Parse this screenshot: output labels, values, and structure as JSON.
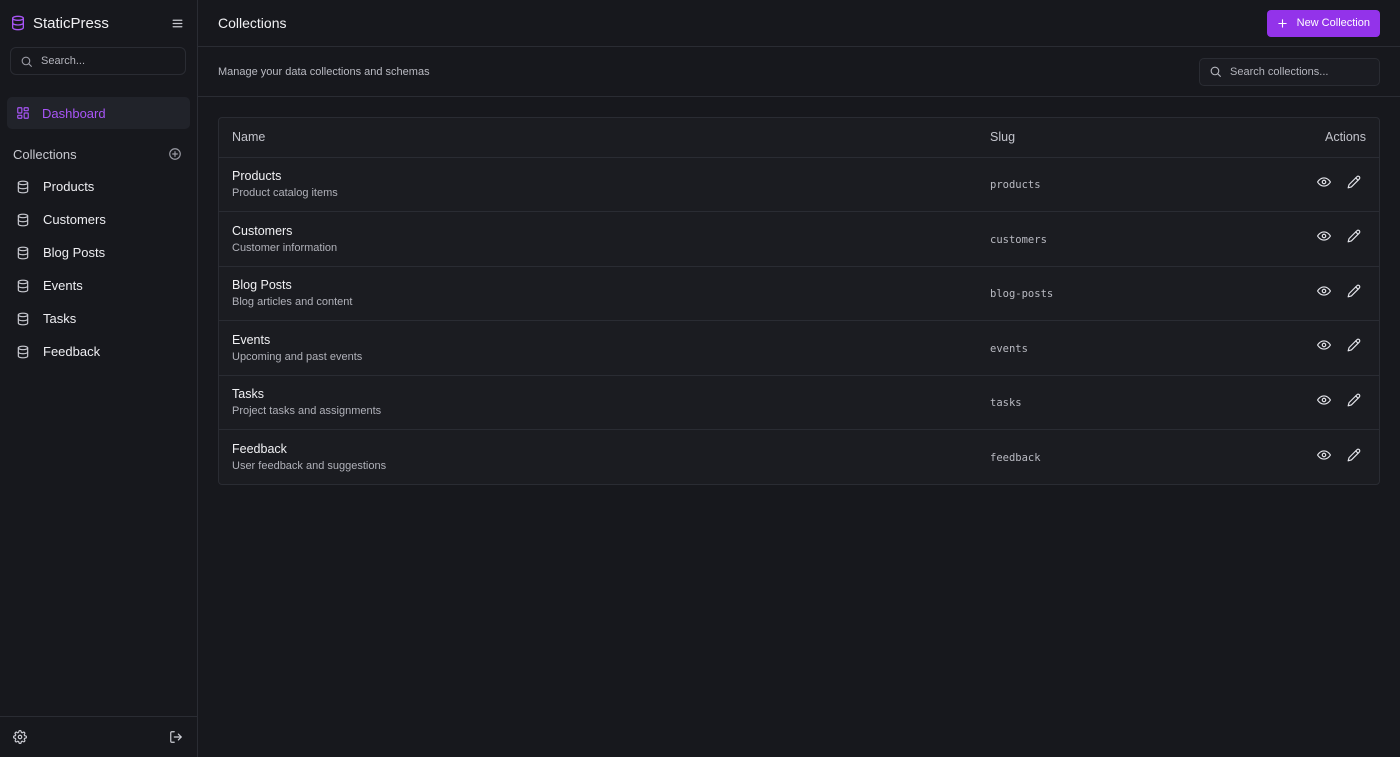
{
  "app": {
    "name": "StaticPress"
  },
  "sidebar": {
    "search_placeholder": "Search...",
    "dashboard_label": "Dashboard",
    "collections_heading": "Collections",
    "items": [
      {
        "label": "Products"
      },
      {
        "label": "Customers"
      },
      {
        "label": "Blog Posts"
      },
      {
        "label": "Events"
      },
      {
        "label": "Tasks"
      },
      {
        "label": "Feedback"
      }
    ]
  },
  "header": {
    "title": "Collections",
    "new_button_label": "New Collection"
  },
  "subheader": {
    "description": "Manage your data collections and schemas",
    "search_placeholder": "Search collections..."
  },
  "table": {
    "columns": {
      "name": "Name",
      "slug": "Slug",
      "actions": "Actions"
    },
    "rows": [
      {
        "name": "Products",
        "description": "Product catalog items",
        "slug": "products"
      },
      {
        "name": "Customers",
        "description": "Customer information",
        "slug": "customers"
      },
      {
        "name": "Blog Posts",
        "description": "Blog articles and content",
        "slug": "blog-posts"
      },
      {
        "name": "Events",
        "description": "Upcoming and past events",
        "slug": "events"
      },
      {
        "name": "Tasks",
        "description": "Project tasks and assignments",
        "slug": "tasks"
      },
      {
        "name": "Feedback",
        "description": "User feedback and suggestions",
        "slug": "feedback"
      }
    ]
  },
  "colors": {
    "accent": "#a855f7",
    "button_bg": "#9333ea",
    "background": "#17181d",
    "border": "#2a2c33"
  },
  "icons": {
    "logo": "database-icon",
    "menu": "hamburger-menu-icon",
    "search": "search-icon",
    "dashboard": "layout-dashboard-icon",
    "add_collection": "plus-circle-icon",
    "collection_item": "database-icon",
    "settings": "gear-icon",
    "logout": "log-out-icon",
    "new": "plus-icon",
    "view": "eye-icon",
    "edit": "pencil-icon"
  }
}
